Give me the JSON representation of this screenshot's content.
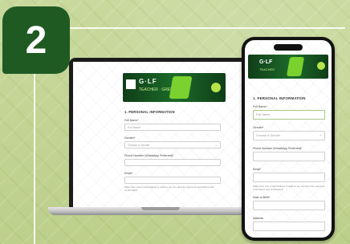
{
  "step": {
    "number": "2"
  },
  "laptop": {
    "banner": {
      "logo": "G·LF",
      "subtitle": "TEACHER · GREEN"
    },
    "form": {
      "section_title": "1. PERSONAL INFORMATION",
      "fields": [
        {
          "label": "Full Name*",
          "value": "",
          "placeholder": "Full Name",
          "type": "text"
        },
        {
          "label": "Gender*",
          "value": "Choose a Gender",
          "type": "select"
        },
        {
          "label": "Phone Number (WhatsApp Preferred)*",
          "value": "",
          "type": "text"
        },
        {
          "label": "Email*",
          "value": "",
          "type": "text"
        }
      ],
      "note": "Make sure your email address is valid so we can send the payment instructions and confirmation"
    }
  },
  "phone": {
    "banner": {
      "logo": "G·LF",
      "subtitle": "TEACHER"
    },
    "form": {
      "section_title": "1. PERSONAL INFORMATION",
      "fields": [
        {
          "label": "Full Name*",
          "placeholder": "Full Name",
          "type": "text"
        },
        {
          "label": "Gender*",
          "value": "Choose a Gender",
          "type": "select"
        },
        {
          "label": "Phone Number (WhatsApp Preferred)*",
          "value": "",
          "type": "text"
        },
        {
          "label": "Email*",
          "value": "",
          "type": "text"
        },
        {
          "label": "Date of Birth*",
          "value": "",
          "type": "text"
        },
        {
          "label": "Address",
          "value": "",
          "type": "text"
        }
      ],
      "note": "Make sure your email address is valid so we can send the payment instructions and confirmation"
    }
  },
  "colors": {
    "badge": "#1f5a23",
    "background": "#c4d497",
    "accent": "#7bd12e"
  }
}
